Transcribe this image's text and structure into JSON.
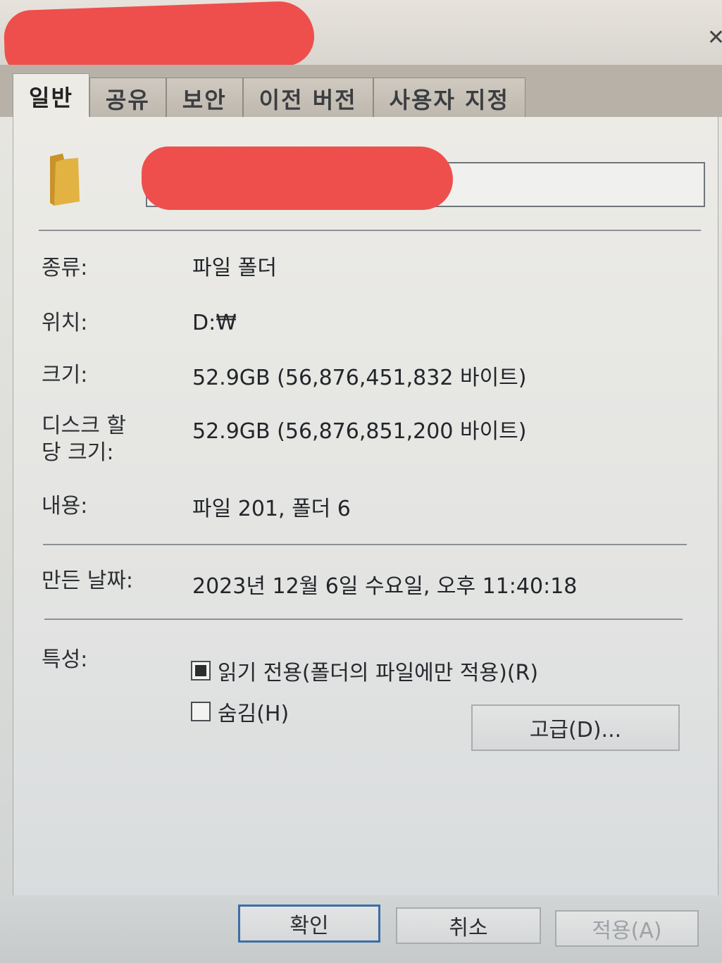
{
  "tabs": [
    {
      "label": "일반"
    },
    {
      "label": "공유"
    },
    {
      "label": "보안"
    },
    {
      "label": "이전 버전"
    },
    {
      "label": "사용자 지정"
    }
  ],
  "general": {
    "type_label": "종류:",
    "type_value": "파일 폴더",
    "location_label": "위치:",
    "location_value": "D:₩",
    "size_label": "크기:",
    "size_value": "52.9GB (56,876,451,832 바이트)",
    "disk_size_label_line1": "디스크 할",
    "disk_size_label_line2": "당 크기:",
    "disk_size_value": "52.9GB (56,876,851,200 바이트)",
    "contents_label": "내용:",
    "contents_value": "파일 201, 폴더 6",
    "created_label": "만든 날짜:",
    "created_value": "2023년 12월 6일 수요일, 오후 11:40:18",
    "attributes_label": "특성:",
    "readonly_label": "읽기 전용(폴더의 파일에만 적용)(R)",
    "hidden_label": "숨김(H)",
    "advanced_label": "고급(D)..."
  },
  "footer": {
    "ok_label": "확인",
    "cancel_label": "취소",
    "apply_label": "적용(A)"
  },
  "colors": {
    "folder": "#e2b243",
    "redaction": "#ef4f4c",
    "primary_border": "#3c6ea6"
  }
}
